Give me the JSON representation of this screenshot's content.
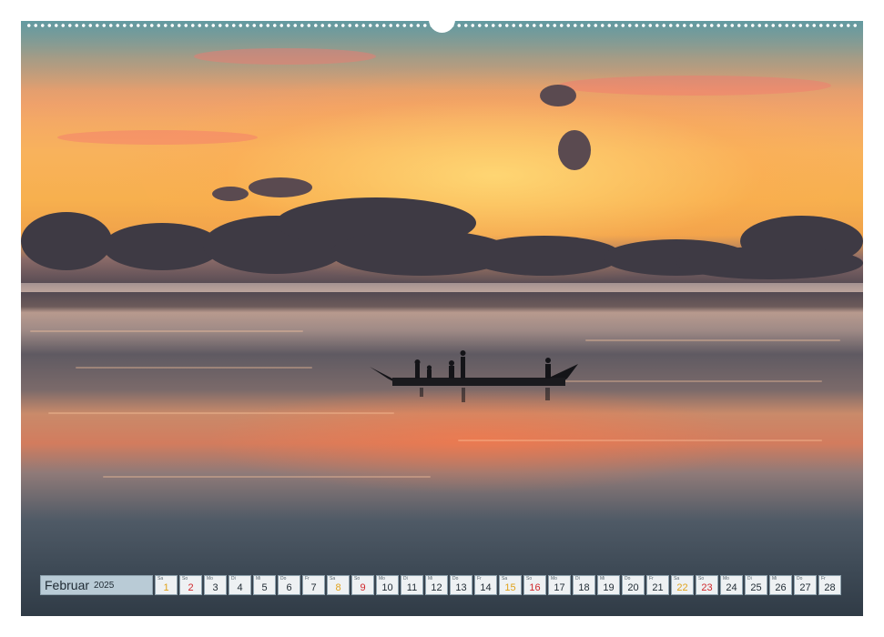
{
  "calendar": {
    "month": "Februar",
    "year": "2025",
    "days": [
      {
        "wd": "Sa",
        "n": "1",
        "type": "sat"
      },
      {
        "wd": "So",
        "n": "2",
        "type": "sun"
      },
      {
        "wd": "Mo",
        "n": "3",
        "type": "week"
      },
      {
        "wd": "Di",
        "n": "4",
        "type": "week"
      },
      {
        "wd": "Mi",
        "n": "5",
        "type": "week"
      },
      {
        "wd": "Do",
        "n": "6",
        "type": "week"
      },
      {
        "wd": "Fr",
        "n": "7",
        "type": "week"
      },
      {
        "wd": "Sa",
        "n": "8",
        "type": "sat"
      },
      {
        "wd": "So",
        "n": "9",
        "type": "sun"
      },
      {
        "wd": "Mo",
        "n": "10",
        "type": "week"
      },
      {
        "wd": "Di",
        "n": "11",
        "type": "week"
      },
      {
        "wd": "Mi",
        "n": "12",
        "type": "week"
      },
      {
        "wd": "Do",
        "n": "13",
        "type": "week"
      },
      {
        "wd": "Fr",
        "n": "14",
        "type": "week"
      },
      {
        "wd": "Sa",
        "n": "15",
        "type": "sat"
      },
      {
        "wd": "So",
        "n": "16",
        "type": "sun"
      },
      {
        "wd": "Mo",
        "n": "17",
        "type": "week"
      },
      {
        "wd": "Di",
        "n": "18",
        "type": "week"
      },
      {
        "wd": "Mi",
        "n": "19",
        "type": "week"
      },
      {
        "wd": "Do",
        "n": "20",
        "type": "week"
      },
      {
        "wd": "Fr",
        "n": "21",
        "type": "week"
      },
      {
        "wd": "Sa",
        "n": "22",
        "type": "sat"
      },
      {
        "wd": "So",
        "n": "23",
        "type": "sun"
      },
      {
        "wd": "Mo",
        "n": "24",
        "type": "week"
      },
      {
        "wd": "Di",
        "n": "25",
        "type": "week"
      },
      {
        "wd": "Mi",
        "n": "26",
        "type": "week"
      },
      {
        "wd": "Do",
        "n": "27",
        "type": "week"
      },
      {
        "wd": "Fr",
        "n": "28",
        "type": "week"
      }
    ]
  },
  "colors": {
    "saturday": "#e0a21a",
    "sunday": "#d0262a",
    "month_cell": "#b9cbd6"
  },
  "image": {
    "scene": "sunset-sea-boat-photo"
  }
}
